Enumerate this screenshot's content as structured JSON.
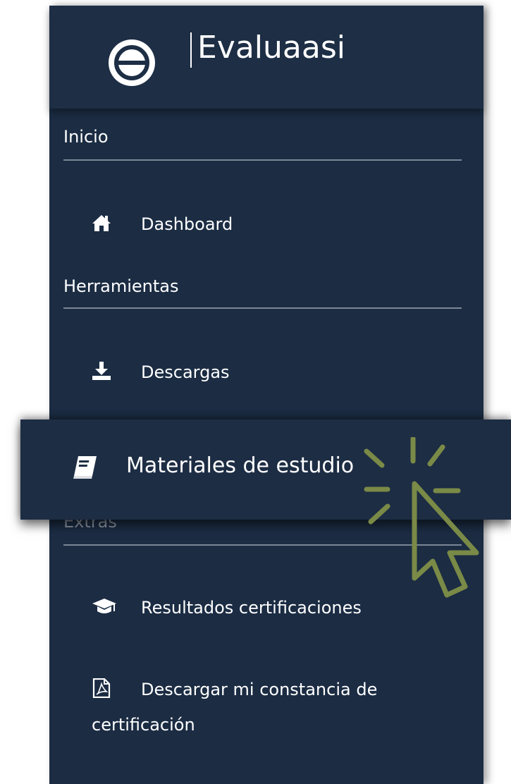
{
  "brand": {
    "name": "Evaluaasi",
    "logo_icon": "circle-theta-logo-icon"
  },
  "colors": {
    "sidebar_bg": "#1b2c43",
    "text": "#ffffff",
    "divider": "#7b8796",
    "cursor_accent": "#7a8a47"
  },
  "sections": [
    {
      "heading": "Inicio",
      "items": [
        {
          "label": "Dashboard",
          "icon": "home-icon"
        }
      ]
    },
    {
      "heading": "Herramientas",
      "items": [
        {
          "label": "Descargas",
          "icon": "download-icon"
        },
        {
          "label": "Materiales de estudio",
          "icon": "book-icon",
          "highlighted": true
        }
      ]
    },
    {
      "heading": "Extras",
      "items": [
        {
          "label": "Resultados certificaciones",
          "icon": "graduation-cap-icon"
        },
        {
          "label_line1": "Descargar mi constancia de",
          "label_line2": "certificación",
          "icon": "pdf-file-icon"
        }
      ]
    }
  ],
  "cursor": {
    "icon": "pointer-cursor-click-icon"
  }
}
